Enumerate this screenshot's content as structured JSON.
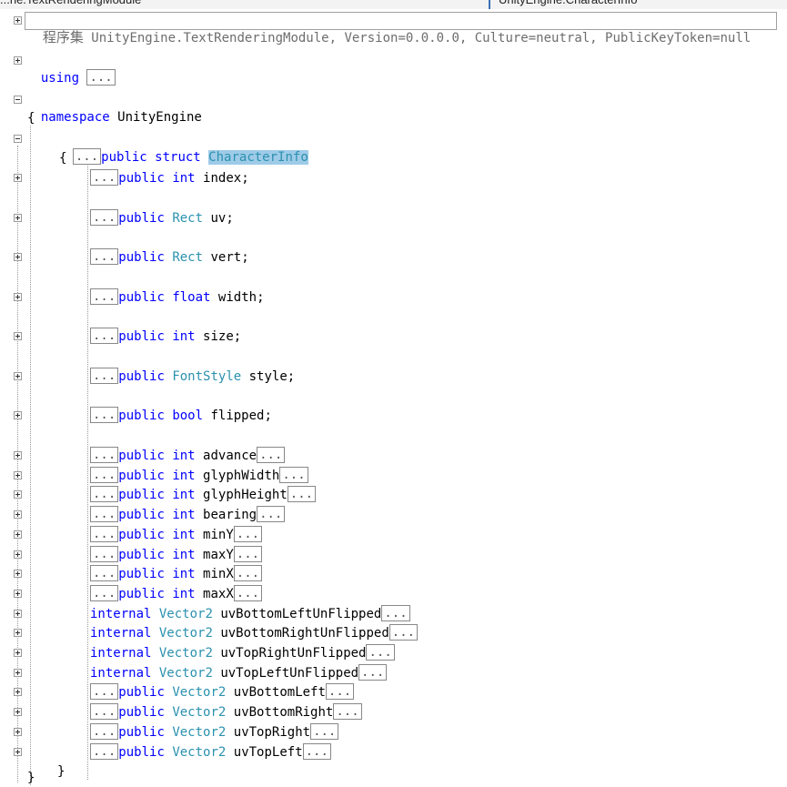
{
  "tabs": {
    "left": "...ne.TextRenderingModule",
    "right": "UnityEngine.CharacterInfo"
  },
  "assembly": {
    "prefix": "程序集",
    "text": " UnityEngine.TextRenderingModule, Version=0.0.0.0, Culture=neutral, PublicKeyToken=null"
  },
  "using": {
    "keyword": "using",
    "collapsed": "..."
  },
  "namespace": {
    "keyword": "namespace",
    "name": " UnityEngine",
    "open": "{",
    "close": "}"
  },
  "struct": {
    "collapsed": "...",
    "modifiers": "public struct ",
    "name": "CharacterInfo",
    "open": "{",
    "close": "}"
  },
  "members": [
    {
      "collapsed": "...",
      "access": "public",
      "type": "int",
      "type_is_class": false,
      "name": "index",
      "suffix": ";",
      "tail": ""
    },
    {
      "collapsed": "...",
      "access": "public",
      "type": "Rect",
      "type_is_class": true,
      "name": "uv",
      "suffix": ";",
      "tail": ""
    },
    {
      "collapsed": "...",
      "access": "public",
      "type": "Rect",
      "type_is_class": true,
      "name": "vert",
      "suffix": ";",
      "tail": ""
    },
    {
      "collapsed": "...",
      "access": "public",
      "type": "float",
      "type_is_class": false,
      "name": "width",
      "suffix": ";",
      "tail": ""
    },
    {
      "collapsed": "...",
      "access": "public",
      "type": "int",
      "type_is_class": false,
      "name": "size",
      "suffix": ";",
      "tail": ""
    },
    {
      "collapsed": "...",
      "access": "public",
      "type": "FontStyle",
      "type_is_class": true,
      "name": "style",
      "suffix": ";",
      "tail": ""
    },
    {
      "collapsed": "...",
      "access": "public",
      "type": "bool",
      "type_is_class": false,
      "name": "flipped",
      "suffix": ";",
      "tail": ""
    }
  ],
  "properties": [
    {
      "collapsed": "...",
      "access": "public",
      "type": "int",
      "type_is_class": false,
      "name": "advance",
      "tail": "..."
    },
    {
      "collapsed": "...",
      "access": "public",
      "type": "int",
      "type_is_class": false,
      "name": "glyphWidth",
      "tail": "..."
    },
    {
      "collapsed": "...",
      "access": "public",
      "type": "int",
      "type_is_class": false,
      "name": "glyphHeight",
      "tail": "..."
    },
    {
      "collapsed": "...",
      "access": "public",
      "type": "int",
      "type_is_class": false,
      "name": "bearing",
      "tail": "..."
    },
    {
      "collapsed": "...",
      "access": "public",
      "type": "int",
      "type_is_class": false,
      "name": "minY",
      "tail": "..."
    },
    {
      "collapsed": "...",
      "access": "public",
      "type": "int",
      "type_is_class": false,
      "name": "maxY",
      "tail": "..."
    },
    {
      "collapsed": "...",
      "access": "public",
      "type": "int",
      "type_is_class": false,
      "name": "minX",
      "tail": "..."
    },
    {
      "collapsed": "...",
      "access": "public",
      "type": "int",
      "type_is_class": false,
      "name": "maxX",
      "tail": "..."
    },
    {
      "collapsed": "",
      "access": "internal",
      "type": "Vector2",
      "type_is_class": true,
      "name": "uvBottomLeftUnFlipped",
      "tail": "..."
    },
    {
      "collapsed": "",
      "access": "internal",
      "type": "Vector2",
      "type_is_class": true,
      "name": "uvBottomRightUnFlipped",
      "tail": "..."
    },
    {
      "collapsed": "",
      "access": "internal",
      "type": "Vector2",
      "type_is_class": true,
      "name": "uvTopRightUnFlipped",
      "tail": "..."
    },
    {
      "collapsed": "",
      "access": "internal",
      "type": "Vector2",
      "type_is_class": true,
      "name": "uvTopLeftUnFlipped",
      "tail": "..."
    },
    {
      "collapsed": "...",
      "access": "public",
      "type": "Vector2",
      "type_is_class": true,
      "name": "uvBottomLeft",
      "tail": "..."
    },
    {
      "collapsed": "...",
      "access": "public",
      "type": "Vector2",
      "type_is_class": true,
      "name": "uvBottomRight",
      "tail": "..."
    },
    {
      "collapsed": "...",
      "access": "public",
      "type": "Vector2",
      "type_is_class": true,
      "name": "uvTopRight",
      "tail": "..."
    },
    {
      "collapsed": "...",
      "access": "public",
      "type": "Vector2",
      "type_is_class": true,
      "name": "uvTopLeft",
      "tail": "..."
    }
  ],
  "colors": {
    "keyword": "#0000ff",
    "type": "#2b91af",
    "highlight": "#9ecbe8",
    "guide": "#9a9a9a"
  }
}
